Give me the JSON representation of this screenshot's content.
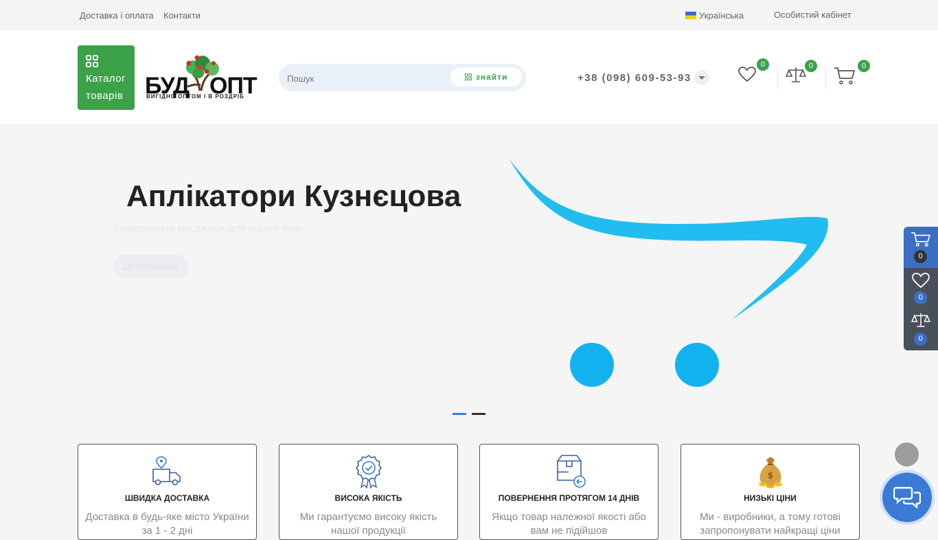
{
  "topbar": {
    "links": [
      "Доставка і оплата",
      "Контакти"
    ],
    "language": "Українська",
    "account": "Особистий кабінет"
  },
  "header": {
    "catalog_line1": "Каталог",
    "catalog_line2": "товарів",
    "logo_word_left": "БУД",
    "logo_word_right": "ОПТ",
    "logo_slogan": "ВИГІДНО ОПТОМ І В РОЗДРІБ",
    "search_placeholder": "Пошук",
    "search_button": "знайти",
    "phone": "+38 (098) 609-53-93",
    "wishlist_count": "0",
    "compare_count": "0",
    "cart_count": "0"
  },
  "hero": {
    "title": "Аплікатори Кузнєцова",
    "subtitle": "Універсальні масажери для всього тіла",
    "button": "Детальніше",
    "slides_total": 2,
    "active_slide": 1
  },
  "features": [
    {
      "title": "ШВИДКА ДОСТАВКА",
      "desc": "Доставка в будь-яке місто України за 1 - 2 дні",
      "icon": "truck-icon"
    },
    {
      "title": "ВИСОКА ЯКІСТЬ",
      "desc": "Ми гарантуємо високу якість нашої продукції",
      "icon": "quality-badge-icon"
    },
    {
      "title": "ПОВЕРНЕННЯ ПРОТЯГОМ 14 ДНІВ",
      "desc": "Якщо товар належної якості або вам не підійшов",
      "icon": "return-box-icon"
    },
    {
      "title": "НИЗЬКІ ЦІНИ",
      "desc": "Ми - виробники, а тому готові запропонувати найкращі ціни",
      "icon": "money-bag-icon"
    }
  ],
  "sidepanel": {
    "cart_count": "0",
    "wishlist_count": "0",
    "compare_count": "0"
  },
  "colors": {
    "brand_green": "#3ca24a",
    "side_blue": "#3a6fc4",
    "side_dark": "#4a505a",
    "hero_cart": "#1fb9ec"
  }
}
